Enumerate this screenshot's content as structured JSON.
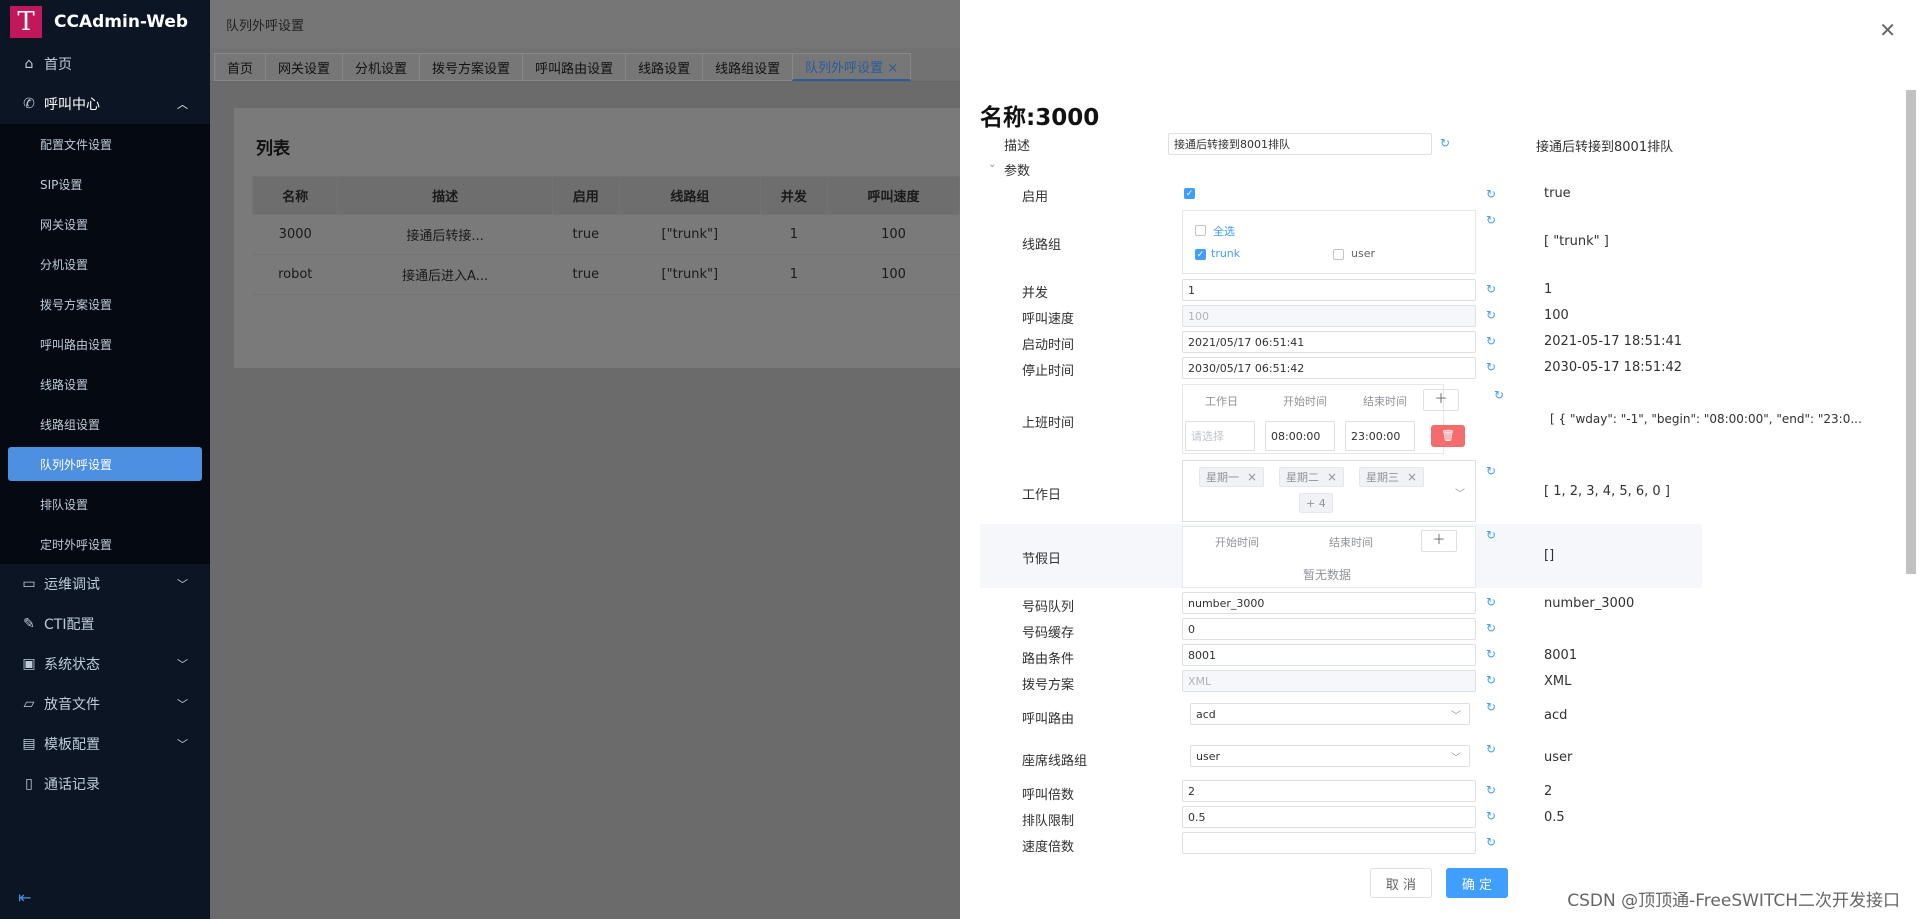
{
  "app": {
    "title": "CCAdmin-Web",
    "logo_letter": "T"
  },
  "sidebar": {
    "home": "首页",
    "call_center": "呼叫中心",
    "sub_items": [
      "配置文件设置",
      "SIP设置",
      "网关设置",
      "分机设置",
      "拨号方案设置",
      "呼叫路由设置",
      "线路设置",
      "线路组设置",
      "队列外呼设置",
      "排队设置",
      "定时外呼设置"
    ],
    "groups": [
      "运维调试",
      "CTI配置",
      "系统状态",
      "放音文件",
      "模板配置",
      "通话记录"
    ]
  },
  "main": {
    "breadcrumb": "队列外呼设置",
    "tabs": [
      "首页",
      "网关设置",
      "分机设置",
      "拨号方案设置",
      "呼叫路由设置",
      "线路设置",
      "线路组设置",
      "队列外呼设置 ×"
    ],
    "card_title": "列表",
    "columns": [
      "名称",
      "描述",
      "启用",
      "线路组",
      "并发",
      "呼叫速度"
    ],
    "rows": [
      [
        "3000",
        "接通后转接...",
        "true",
        "[\"trunk\"]",
        "1",
        "100"
      ],
      [
        "robot",
        "接通后进入A...",
        "true",
        "[\"trunk\"]",
        "1",
        "100"
      ]
    ]
  },
  "drawer": {
    "title": "名称:3000",
    "desc_label": "描述",
    "desc_value": "接通后转接到8001排队",
    "desc_current": "接通后转接到8001排队",
    "params_label": "参数",
    "enable_label": "启用",
    "enable_current": "true",
    "trunk_label": "线路组",
    "select_all": "全选",
    "opt_trunk": "trunk",
    "opt_user": "user",
    "trunk_current": "[ \"trunk\" ]",
    "concurrent_label": "并发",
    "concurrent_value": "1",
    "concurrent_current": "1",
    "speed_label": "呼叫速度",
    "speed_value": "100",
    "speed_current": "100",
    "start_label": "启动时间",
    "start_value": "2021/05/17 06:51:41",
    "start_current": "2021-05-17 18:51:41",
    "stop_label": "停止时间",
    "stop_value": "2030/05/17 06:51:42",
    "stop_current": "2030-05-17 18:51:42",
    "work_time_label": "上班时间",
    "wt_col1": "工作日",
    "wt_col2": "开始时间",
    "wt_col3": "结束时间",
    "wt_select_placeholder": "请选择",
    "wt_begin": "08:00:00",
    "wt_end": "23:00:00",
    "work_time_current": "[ { \"wday\": \"-1\", \"begin\": \"08:00:00\", \"end\": \"23:0...",
    "workday_label": "工作日",
    "workday_tags": [
      "星期一",
      "星期二",
      "星期三"
    ],
    "workday_more": "+ 4",
    "workday_current": "[ 1, 2, 3, 4, 5, 6, 0 ]",
    "holiday_label": "节假日",
    "hd_col1": "开始时间",
    "hd_col2": "结束时间",
    "hd_empty": "暂无数据",
    "holiday_current": "[]",
    "queue_label": "号码队列",
    "queue_value": "number_3000",
    "queue_current": "number_3000",
    "cache_label": "号码缓存",
    "cache_value": "0",
    "route_cond_label": "路由条件",
    "route_cond_value": "8001",
    "route_cond_current": "8001",
    "dialplan_label": "拨号方案",
    "dialplan_value": "XML",
    "dialplan_current": "XML",
    "call_route_label": "呼叫路由",
    "call_route_value": "acd",
    "call_route_current": "acd",
    "agent_trunk_label": "座席线路组",
    "agent_trunk_value": "user",
    "agent_trunk_current": "user",
    "multiplier_label": "呼叫倍数",
    "multiplier_value": "2",
    "multiplier_current": "2",
    "queue_limit_label": "排队限制",
    "queue_limit_value": "0.5",
    "queue_limit_current": "0.5",
    "speed_mult_label": "速度倍数",
    "speed_mult_value": "",
    "cancel": "取 消",
    "confirm": "确 定"
  },
  "watermark": "CSDN @顶顶通-FreeSWITCH二次开发接口"
}
